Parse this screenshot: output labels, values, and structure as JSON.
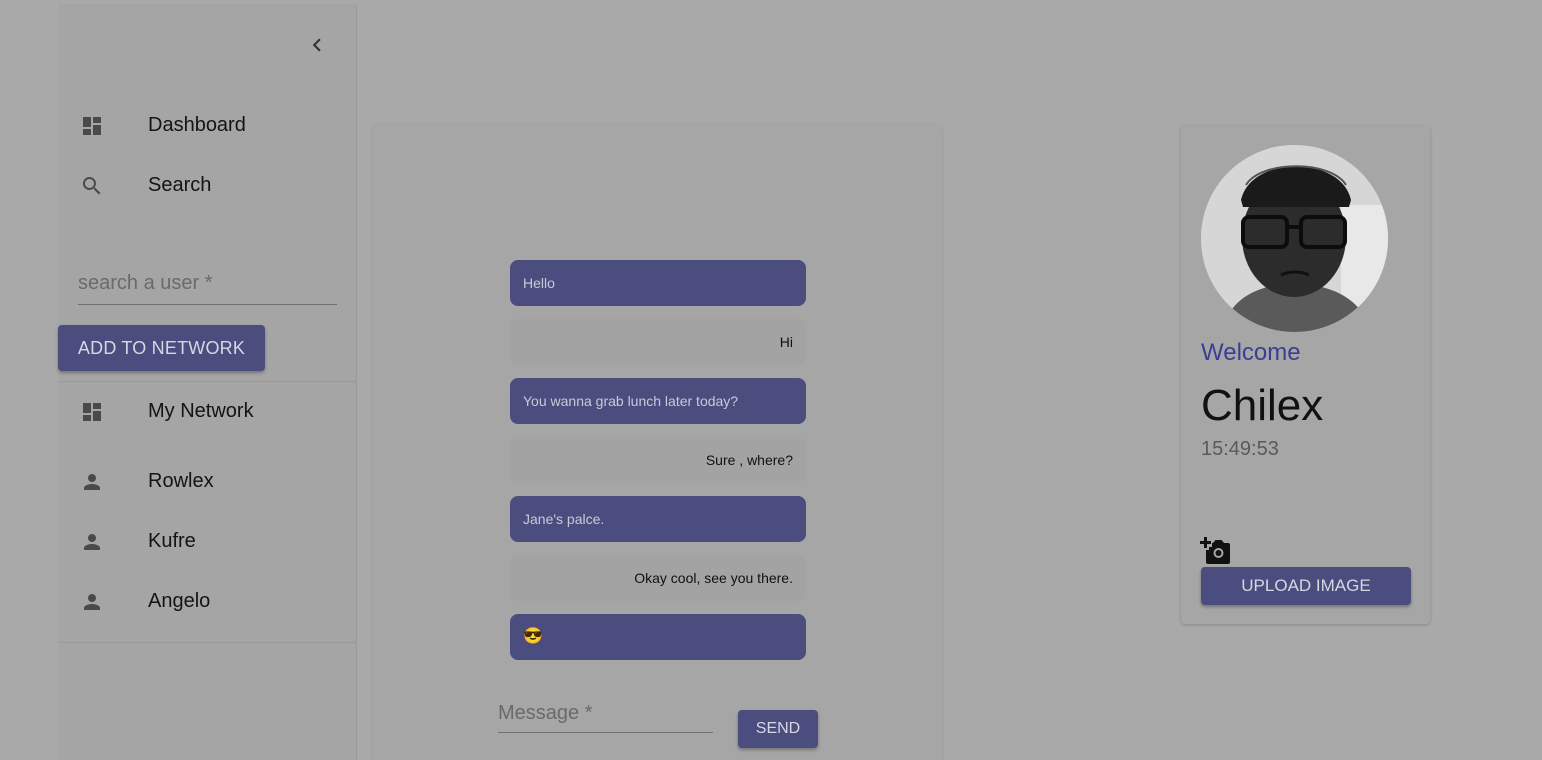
{
  "sidebar": {
    "collapse_icon": "chevron-left-icon",
    "nav": [
      {
        "label": "Dashboard",
        "icon": "dashboard-icon"
      },
      {
        "label": "Search",
        "icon": "search-icon"
      }
    ],
    "user_search": {
      "placeholder": "search a user *",
      "value": ""
    },
    "add_network_label": "ADD TO NETWORK",
    "network_header": {
      "label": "My Network",
      "icon": "dashboard-icon"
    },
    "network_users": [
      {
        "label": "Rowlex",
        "icon": "person-icon"
      },
      {
        "label": "Kufre",
        "icon": "person-icon"
      },
      {
        "label": "Angelo",
        "icon": "person-icon"
      }
    ]
  },
  "chat": {
    "messages": [
      {
        "text": "Hello",
        "from": "me"
      },
      {
        "text": "Hi",
        "from": "them"
      },
      {
        "text": "You wanna grab lunch later today?",
        "from": "me"
      },
      {
        "text": "Sure , where?",
        "from": "them"
      },
      {
        "text": "Jane's palce.",
        "from": "me"
      },
      {
        "text": "Okay cool, see you there.",
        "from": "them"
      },
      {
        "text": "😎",
        "from": "me"
      }
    ],
    "message_input": {
      "placeholder": "Message *",
      "value": ""
    },
    "send_label": "SEND"
  },
  "profile": {
    "welcome": "Welcome",
    "name": "Chilex",
    "time": "15:49:53",
    "camera_icon": "add-a-photo-icon",
    "upload_label": "UPLOAD IMAGE"
  },
  "colors": {
    "background": "#a9a9a9",
    "primary": "#4b4d7f",
    "welcome": "#3a3e94"
  }
}
